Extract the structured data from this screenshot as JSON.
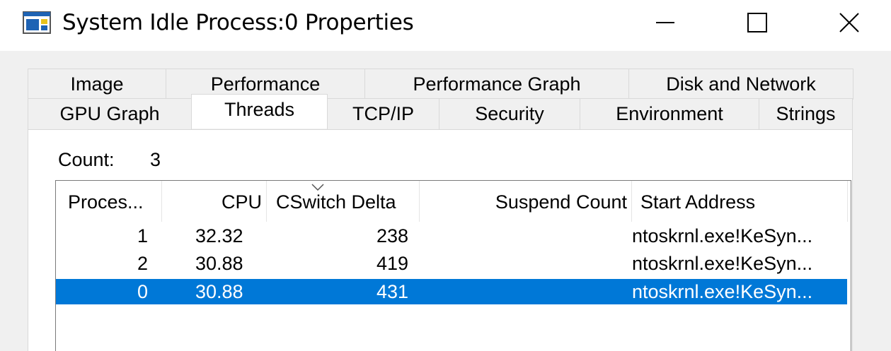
{
  "window": {
    "title": "System Idle Process:0 Properties",
    "controls": [
      "minimize",
      "maximize",
      "close"
    ]
  },
  "tabs": {
    "row1": [
      "Image",
      "Performance",
      "Performance Graph",
      "Disk and Network"
    ],
    "row2": [
      "GPU Graph",
      "Threads",
      "TCP/IP",
      "Security",
      "Environment",
      "Strings"
    ],
    "active": "Threads"
  },
  "threads": {
    "count_label": "Count:",
    "count_value": "3",
    "columns": [
      "Proces...",
      "CPU",
      "CSwitch Delta",
      "Suspend Count",
      "Start Address"
    ],
    "sort_column": "CPU",
    "rows": [
      {
        "proc": "1",
        "cpu": "32.32",
        "cswitch": "238",
        "suspend": "",
        "start": "ntoskrnl.exe!KeSyn...",
        "selected": false
      },
      {
        "proc": "2",
        "cpu": "30.88",
        "cswitch": "419",
        "suspend": "",
        "start": "ntoskrnl.exe!KeSyn...",
        "selected": false
      },
      {
        "proc": "0",
        "cpu": "30.88",
        "cswitch": "431",
        "suspend": "",
        "start": "ntoskrnl.exe!KeSyn...",
        "selected": true
      }
    ]
  },
  "colors": {
    "selection": "#0078d7",
    "dialog_bg": "#f0f0f0",
    "tab_border": "#d9d9d9"
  }
}
